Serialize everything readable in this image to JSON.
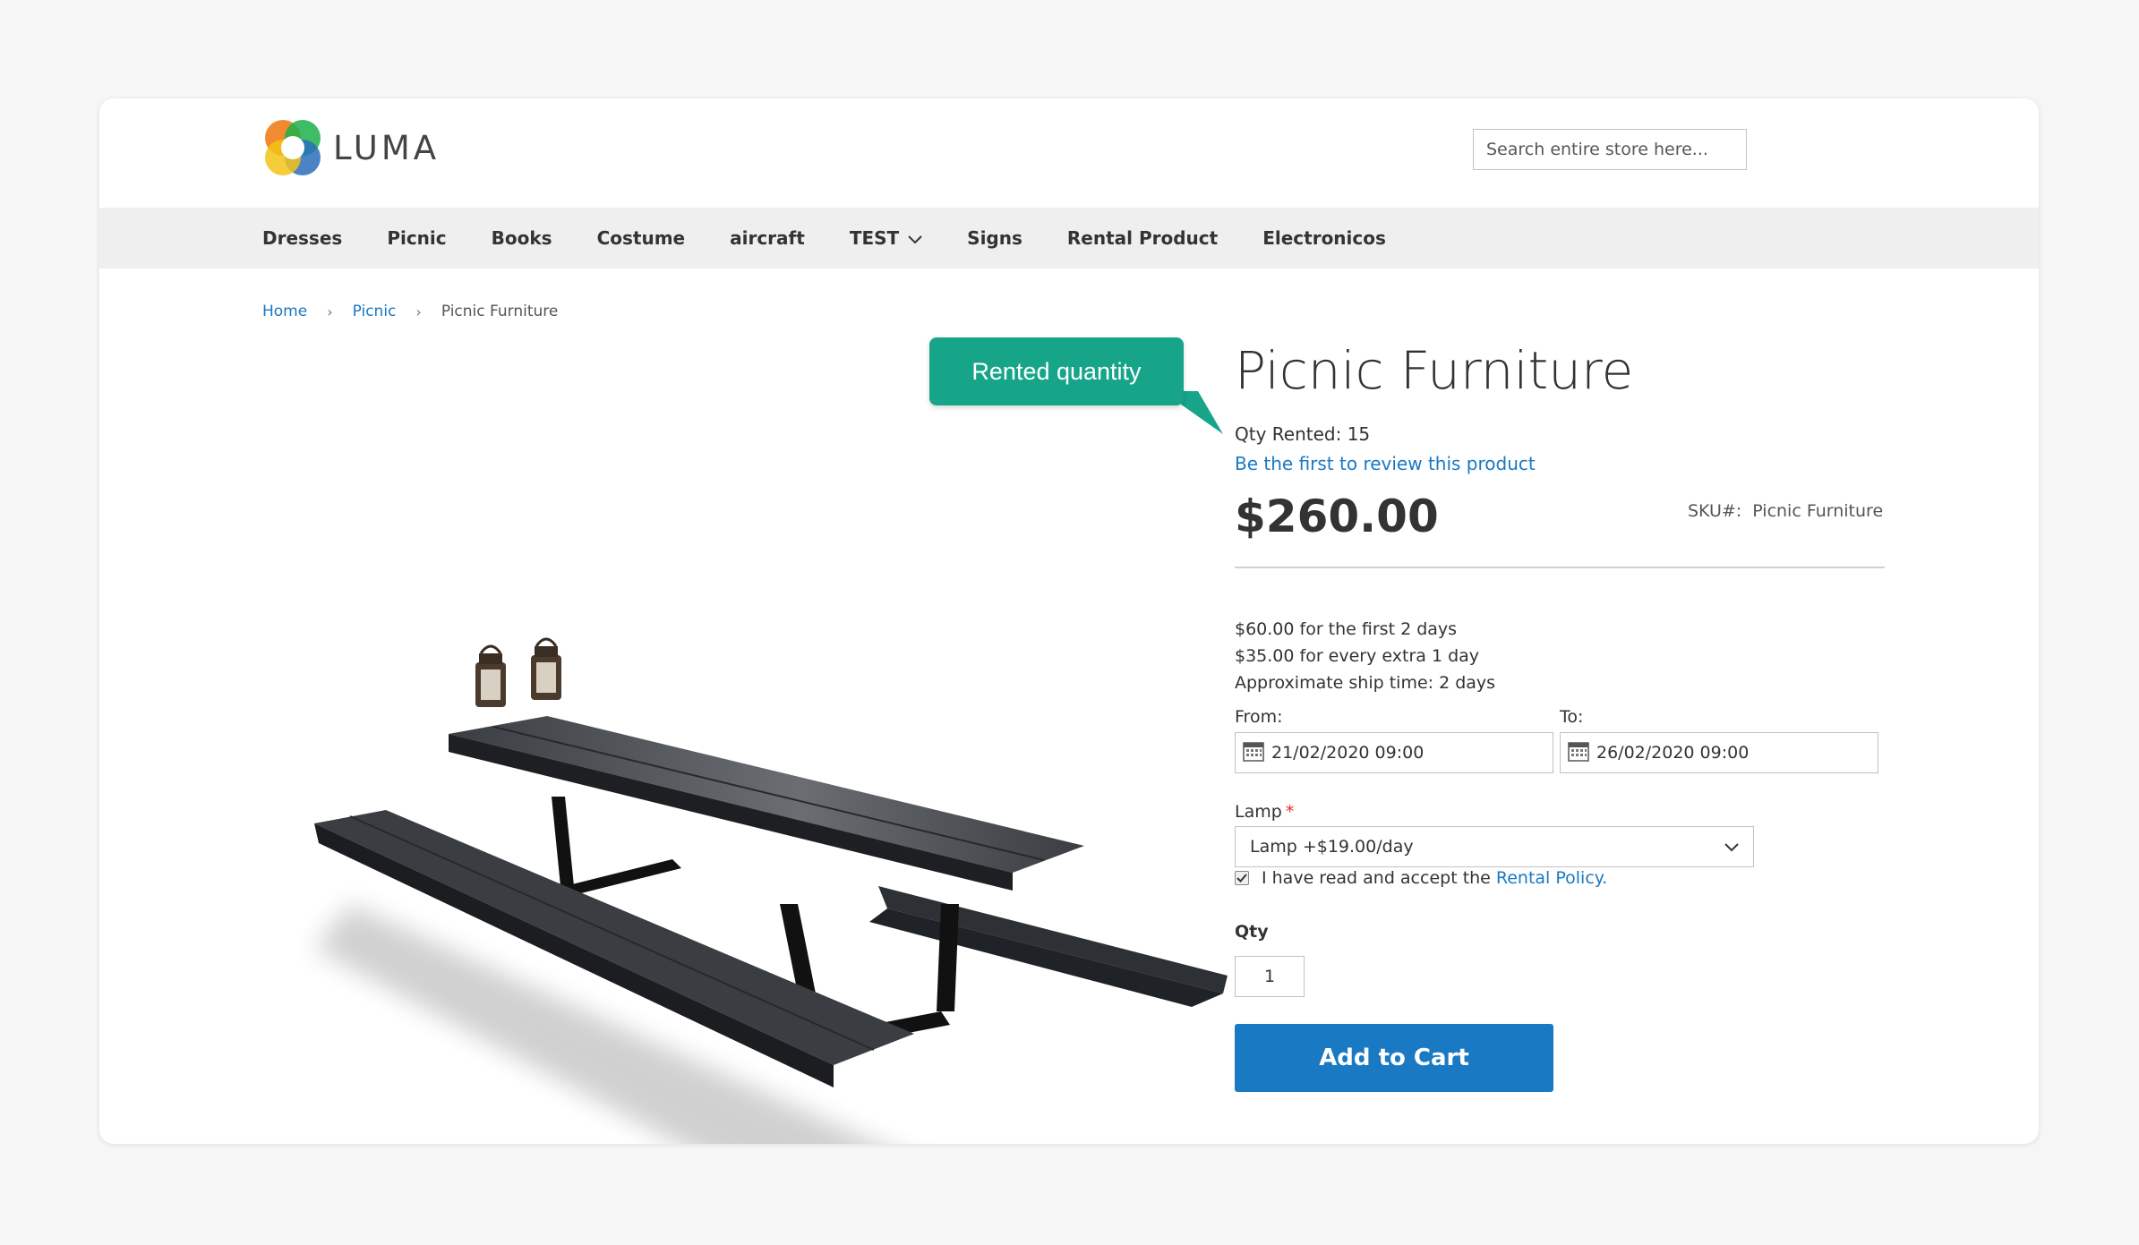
{
  "brand": {
    "name": "LUMA"
  },
  "search": {
    "placeholder": "Search entire store here..."
  },
  "nav": {
    "items": [
      "Dresses",
      "Picnic",
      "Books",
      "Costume",
      "aircraft",
      "TEST",
      "Signs",
      "Rental Product",
      "Electronicos"
    ]
  },
  "breadcrumb": {
    "home": "Home",
    "category": "Picnic",
    "current": "Picnic Furniture",
    "separator": "›"
  },
  "callout": {
    "text": "Rented quantity"
  },
  "product": {
    "title": "Picnic Furniture",
    "qty_rented": "Qty Rented: 15",
    "review_link": "Be the first to review this product",
    "price": "$260.00",
    "sku_label": "SKU#:",
    "sku_value": "Picnic Furniture",
    "rental_info": [
      "$60.00 for the first 2 days",
      "$35.00 for every extra 1 day",
      "Approximate ship time: 2 days"
    ],
    "from_label": "From:",
    "from_value": "21/02/2020 09:00",
    "to_label": "To:",
    "to_value": "26/02/2020 09:00",
    "lamp_label": "Lamp",
    "required_mark": "*",
    "lamp_selected": "Lamp +$19.00/day",
    "policy_text": "I have read and accept the",
    "policy_link": "Rental Policy.",
    "policy_checked": true,
    "qty_label": "Qty",
    "qty_value": "1",
    "add_to_cart": "Add to Cart"
  },
  "colors": {
    "accent": "#1979c3",
    "callout": "#17a589",
    "nav_bg": "#efefef"
  }
}
